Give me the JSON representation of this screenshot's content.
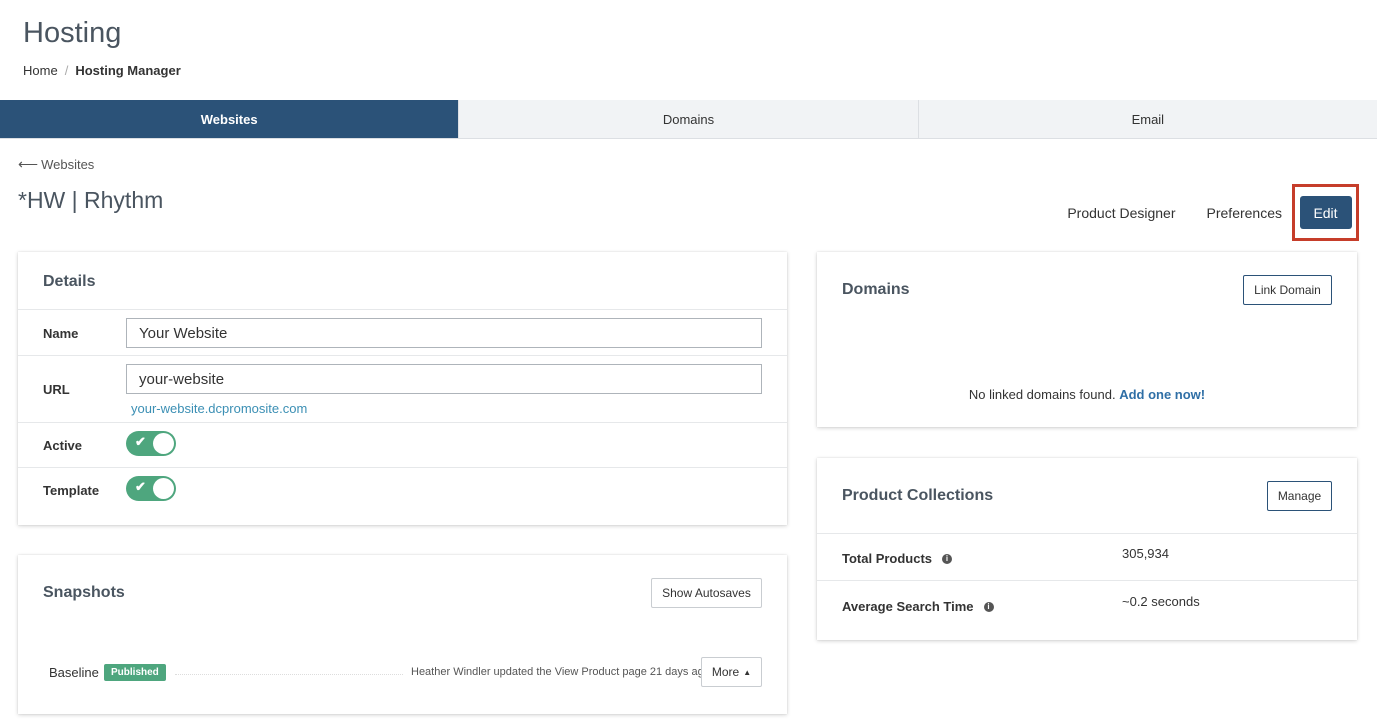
{
  "header": {
    "title": "Hosting",
    "breadcrumb": {
      "home": "Home",
      "separator": "/",
      "current": "Hosting Manager"
    }
  },
  "tabs": [
    {
      "label": "Websites",
      "active": true
    },
    {
      "label": "Domains",
      "active": false
    },
    {
      "label": "Email",
      "active": false
    }
  ],
  "back_link": {
    "icon": "arrow-left-icon",
    "label": "Websites"
  },
  "site": {
    "title": "*HW | Rhythm"
  },
  "actions": {
    "product_designer": "Product Designer",
    "preferences": "Preferences",
    "edit": "Edit",
    "highlight_color": "#c63d2a"
  },
  "details": {
    "title": "Details",
    "name_label": "Name",
    "name_value": "Your Website",
    "url_label": "URL",
    "url_value": "your-website",
    "url_hint": "your-website.dcpromosite.com",
    "active_label": "Active",
    "active_on": true,
    "template_label": "Template",
    "template_on": true
  },
  "snapshots": {
    "title": "Snapshots",
    "show_autosaves": "Show Autosaves",
    "items": [
      {
        "name": "Baseline",
        "badge": "Published",
        "meta": "Heather Windler updated the View Product page 21 days ago",
        "more": "More"
      }
    ]
  },
  "domains": {
    "title": "Domains",
    "link_button": "Link Domain",
    "empty_text": "No linked domains found.",
    "empty_link": "Add one now!"
  },
  "collections": {
    "title": "Product Collections",
    "manage_button": "Manage",
    "stats": [
      {
        "label": "Total Products",
        "value": "305,934"
      },
      {
        "label": "Average Search Time",
        "value": "~0.2 seconds"
      }
    ]
  },
  "colors": {
    "primary": "#2b5278",
    "success": "#4ea67e",
    "link": "#2f6fa6"
  }
}
